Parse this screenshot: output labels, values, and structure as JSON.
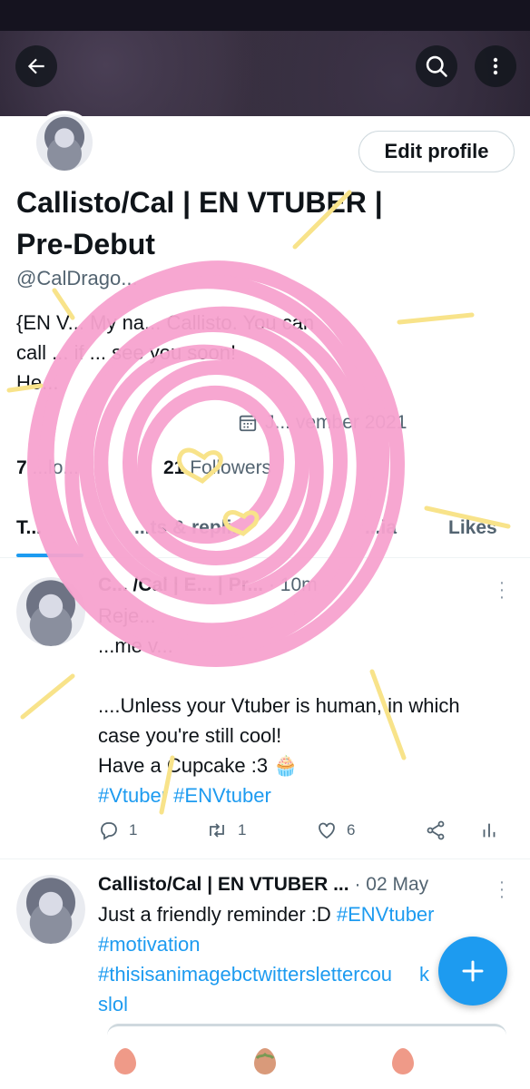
{
  "profile": {
    "edit_label": "Edit profile",
    "name_line1": "Callisto/Cal | EN VTUBER |",
    "name_line2": "Pre-Debut",
    "handle": "@CalDrago...",
    "bio_line1": "{EN V... My na... Callisto. You can",
    "bio_line2": "call ... if ... see you soon!",
    "bio_line3": "He...",
    "joined": "J... vember 2021",
    "following_count": "7",
    "following_label": "...lo...",
    "followers_count": "21",
    "followers_label": "Followers"
  },
  "tabs": [
    {
      "label": "T...",
      "active": true
    },
    {
      "label": "...ts & repli...",
      "active": false
    },
    {
      "label": "...ia",
      "active": false
    },
    {
      "label": "Likes",
      "active": false
    }
  ],
  "tweets": [
    {
      "author": "C... /Cal | E... | Pr...",
      "time": "· 10m",
      "line1": "Reje...",
      "line2": "...me v...",
      "line3": "....Unless your Vtuber is human, in which",
      "line4": "case you're still cool!",
      "line5": "Have a Cupcake :3 🧁",
      "tags": "#Vtuber #ENVtuber",
      "replies": "1",
      "retweets": "1",
      "likes": "6"
    },
    {
      "author": "Callisto/Cal | EN VTUBER ...",
      "time": "· 02 May",
      "line1_text": "Just a friendly reminder :D ",
      "line1_tag": "#ENVtuber",
      "line2": "#motivation",
      "line3": "#thisisanimagebctwitterslettercou",
      "line3b": "k",
      "line4": "slol"
    }
  ],
  "icons": [
    "back-arrow-icon",
    "search-icon",
    "more-vertical-icon",
    "calendar-icon",
    "reply-icon",
    "retweet-icon",
    "heart-icon",
    "share-icon",
    "analytics-icon",
    "plus-icon"
  ],
  "colors": {
    "accent": "#1d9bf0",
    "scribble_pink": "#f7a3cf",
    "scribble_yellow": "#f8e38a"
  }
}
